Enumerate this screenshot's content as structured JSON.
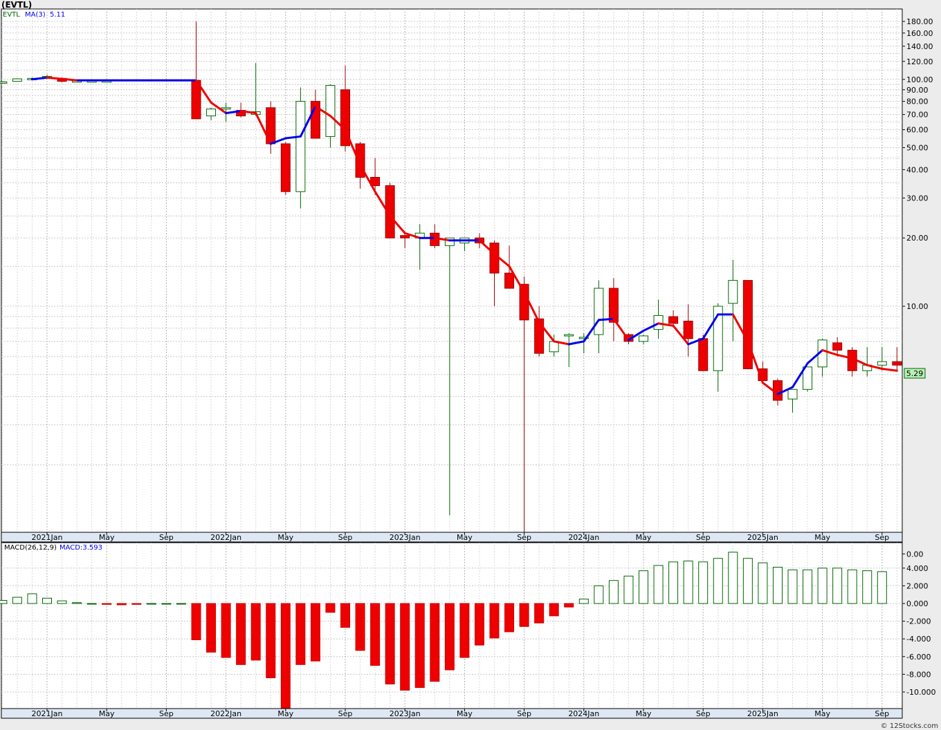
{
  "title": "(EVTL)",
  "footer": "© 12Stocks.com",
  "price_legend": {
    "symbol": "EVTL",
    "ma_label": "MA(3)",
    "ma_value": "5.11"
  },
  "macd_legend": {
    "label": "MACD(26,12,9)",
    "value": "MACD:3.593"
  },
  "last_price_label": "5.29",
  "colors": {
    "up": "#ffffff",
    "up_border": "#006600",
    "down": "#ee0000",
    "ma_up": "#0000ee",
    "ma_down": "#ee0000",
    "last_box": "#b8f0b8"
  },
  "chart_data": [
    {
      "type": "candlestick",
      "scale": "log",
      "y_tick_labels": [
        "180.00",
        "160.00",
        "140.00",
        "120.00",
        "100.00",
        "90.00",
        "80.00",
        "70.00",
        "60.00",
        "50.00",
        "40.00",
        "30.00",
        "20.00",
        "10.00",
        "0.00"
      ],
      "y_tick_values": [
        180,
        160,
        140,
        120,
        100,
        90,
        80,
        70,
        60,
        50,
        40,
        30,
        20,
        10,
        0.81
      ],
      "x_tick_labels": [
        "2021Jan",
        "May",
        "Sep",
        "2022Jan",
        "May",
        "Sep",
        "2023Jan",
        "May",
        "Sep",
        "2024Jan",
        "May",
        "Sep",
        "2025Jan",
        "May",
        "Sep"
      ],
      "x_tick_months": [
        0,
        4,
        8,
        12,
        16,
        20,
        24,
        28,
        32,
        36,
        40,
        44,
        48,
        52,
        56
      ],
      "months": [
        -3,
        -2,
        -1,
        0,
        1,
        2,
        3,
        4,
        10,
        11,
        12,
        13,
        14,
        15,
        16,
        17,
        18,
        19,
        20,
        21,
        22,
        23,
        24,
        25,
        26,
        27,
        28,
        29,
        30,
        31,
        32,
        33,
        34,
        35,
        36,
        37,
        38,
        39,
        40,
        41,
        42,
        43,
        44,
        45,
        46,
        47,
        48,
        49,
        50,
        51,
        52,
        53,
        54,
        55,
        56,
        57
      ],
      "candles": [
        [
          97.5,
          98,
          97,
          97.5
        ],
        [
          98,
          101,
          97.5,
          100.5
        ],
        [
          101,
          102,
          100,
          101
        ],
        [
          102,
          105,
          100,
          103
        ],
        [
          101,
          102,
          97,
          98
        ],
        [
          98.5,
          99,
          98,
          98.5
        ],
        [
          98.5,
          99,
          98,
          98.5
        ],
        [
          98.5,
          99,
          98,
          98.5
        ],
        [
          99,
          180,
          67,
          67
        ],
        [
          69,
          75,
          66,
          74
        ],
        [
          74,
          79,
          65,
          75
        ],
        [
          73,
          79,
          68,
          69
        ],
        [
          70,
          118,
          69,
          72
        ],
        [
          75,
          80,
          47,
          52
        ],
        [
          52,
          53,
          31,
          32
        ],
        [
          32,
          92,
          27,
          80
        ],
        [
          80,
          90,
          55,
          55
        ],
        [
          56,
          95,
          50,
          94
        ],
        [
          90,
          115,
          48,
          51
        ],
        [
          52,
          53,
          33,
          37
        ],
        [
          37,
          45,
          31,
          34
        ],
        [
          34,
          35,
          20,
          20
        ],
        [
          20.5,
          21,
          18,
          20
        ],
        [
          20,
          23,
          14.5,
          21
        ],
        [
          21,
          23,
          18,
          18.5
        ],
        [
          18.5,
          19,
          1.2,
          20
        ],
        [
          19,
          20,
          17.5,
          20
        ],
        [
          20,
          21,
          18,
          19
        ],
        [
          19,
          19.5,
          10,
          14
        ],
        [
          14,
          18.5,
          12,
          12
        ],
        [
          12.5,
          13.5,
          0.81,
          8.7
        ],
        [
          8.8,
          10,
          6,
          6.2
        ],
        [
          6.3,
          7.5,
          6,
          7
        ],
        [
          7.4,
          7.6,
          5.4,
          7.5
        ],
        [
          7.2,
          7.6,
          6.2,
          7.3
        ],
        [
          7.5,
          13,
          6.2,
          12
        ],
        [
          12,
          13.3,
          7,
          8.5
        ],
        [
          7.5,
          7.6,
          6.8,
          7
        ],
        [
          7,
          7.5,
          6.8,
          7.4
        ],
        [
          7.9,
          10.7,
          7.2,
          9.1
        ],
        [
          9,
          9.6,
          8.2,
          8.4
        ],
        [
          8.6,
          10.2,
          6,
          7.2
        ],
        [
          7.2,
          7.5,
          5.2,
          5.2
        ],
        [
          5.2,
          10.3,
          4.2,
          10
        ],
        [
          10.3,
          16,
          7,
          13
        ],
        [
          13,
          13,
          5.3,
          5.3
        ],
        [
          5.3,
          5.7,
          4.6,
          4.7
        ],
        [
          4.7,
          4.8,
          3.65,
          3.85
        ],
        [
          3.9,
          4.3,
          3.4,
          4.3
        ],
        [
          4.3,
          5.4,
          4.2,
          5.4
        ],
        [
          5.4,
          7.2,
          4.9,
          7.1
        ],
        [
          6.9,
          7.3,
          6,
          6.4
        ],
        [
          6.4,
          6.6,
          4.9,
          5.2
        ],
        [
          5.2,
          6.6,
          4.9,
          5.5
        ],
        [
          5.5,
          6.6,
          5.2,
          5.7
        ],
        [
          5.7,
          6.6,
          5.2,
          5.5
        ]
      ],
      "ma_points": [
        [
          -1,
          100
        ],
        [
          0,
          101.8
        ],
        [
          1,
          100.5
        ],
        [
          2,
          99
        ],
        [
          10,
          99
        ],
        [
          11,
          79
        ],
        [
          12,
          71
        ],
        [
          13,
          72.5
        ],
        [
          14,
          71
        ],
        [
          15,
          52
        ],
        [
          16,
          55
        ],
        [
          17,
          56
        ],
        [
          18,
          76
        ],
        [
          19,
          69
        ],
        [
          20,
          60
        ],
        [
          21,
          42
        ],
        [
          22,
          32
        ],
        [
          23,
          25
        ],
        [
          24,
          21
        ],
        [
          25,
          20
        ],
        [
          26,
          20
        ],
        [
          27,
          19.5
        ],
        [
          28,
          19.5
        ],
        [
          29,
          19.5
        ],
        [
          30,
          17
        ],
        [
          31,
          15
        ],
        [
          32,
          11.5
        ],
        [
          33,
          8.5
        ],
        [
          34,
          7
        ],
        [
          35,
          6.8
        ],
        [
          36,
          7
        ],
        [
          37,
          8.7
        ],
        [
          38,
          8.8
        ],
        [
          39,
          7.1
        ],
        [
          40,
          7.8
        ],
        [
          41,
          8.4
        ],
        [
          42,
          8.2
        ],
        [
          43,
          6.8
        ],
        [
          44,
          7.2
        ],
        [
          45,
          9.2
        ],
        [
          46,
          9.2
        ],
        [
          47,
          7
        ],
        [
          48,
          4.6
        ],
        [
          49,
          4.1
        ],
        [
          50,
          4.4
        ],
        [
          51,
          5.6
        ],
        [
          52,
          6.4
        ],
        [
          53,
          6.1
        ],
        [
          54,
          5.9
        ],
        [
          55,
          5.5
        ],
        [
          56,
          5.3
        ],
        [
          57,
          5.2
        ]
      ]
    },
    {
      "type": "bar",
      "y_tick_labels": [
        "4.000",
        "2.000",
        "0.000",
        "-2.000",
        "-4.000",
        "-6.000",
        "-8.000",
        "-10.000"
      ],
      "y_tick_values": [
        4,
        2,
        0,
        -2,
        -4,
        -6,
        -8,
        -10
      ],
      "x_tick_labels": [
        "2021Jan",
        "May",
        "Sep",
        "2022Jan",
        "May",
        "Sep",
        "2023Jan",
        "May",
        "Sep",
        "2024Jan",
        "May",
        "Sep",
        "2025Jan",
        "May",
        "Sep"
      ],
      "months": [
        -3,
        -2,
        -1,
        0,
        1,
        2,
        3,
        4,
        5,
        6,
        7,
        8,
        9,
        10,
        11,
        12,
        13,
        14,
        15,
        16,
        17,
        18,
        19,
        20,
        21,
        22,
        23,
        24,
        25,
        26,
        27,
        28,
        29,
        30,
        31,
        32,
        33,
        34,
        35,
        36,
        37,
        38,
        39,
        40,
        41,
        42,
        43,
        44,
        45,
        46,
        47,
        48,
        49,
        50,
        51,
        52,
        53,
        54,
        55,
        56,
        57
      ],
      "values": [
        0.35,
        0.7,
        1.1,
        0.6,
        0.3,
        0.1,
        0,
        -0.1,
        -0.15,
        -0.1,
        0,
        0,
        0,
        -4.1,
        -5.5,
        -6.1,
        -6.9,
        -6.4,
        -8.4,
        -11.8,
        -6.9,
        -6.5,
        -1,
        -2.7,
        -5.3,
        -7,
        -9.1,
        -9.8,
        -9.5,
        -8.8,
        -7.5,
        -6.1,
        -4.7,
        -3.9,
        -3.2,
        -2.6,
        -2.2,
        -1.4,
        -0.4,
        0.5,
        2,
        2.6,
        3.1,
        3.7,
        4.3,
        4.7,
        4.8,
        4.7,
        5.1,
        5.8,
        5.1,
        4.6,
        4.1,
        3.8,
        3.8,
        4,
        4,
        3.8,
        3.7,
        3.6
      ]
    }
  ]
}
